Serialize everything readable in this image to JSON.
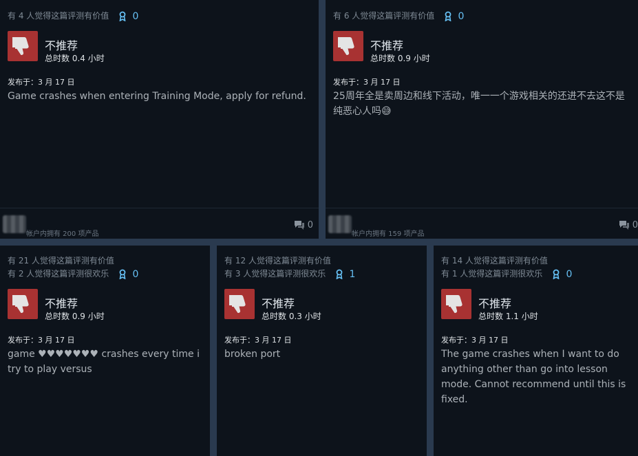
{
  "reviews": [
    {
      "helpful": "有 4 人觉得这篇评测有价值",
      "funny": "",
      "awards": "0",
      "verdict": "不推荐",
      "hours": "总时数 0.4 小时",
      "posted": "发布于：3 月 17 日",
      "body": "Game crashes when entering Training Mode, apply for refund.",
      "owned": "帐户内拥有 200 项产品",
      "comments": "0"
    },
    {
      "helpful": "有 6 人觉得这篇评测有价值",
      "funny": "",
      "awards": "0",
      "verdict": "不推荐",
      "hours": "总时数 0.9 小时",
      "posted": "发布于：3 月 17 日",
      "body": "25周年全是卖周边和线下活动，唯一一个游戏相关的还进不去这不是纯恶心人吗😅",
      "owned": "帐户内拥有 159 项产品",
      "comments": "0"
    },
    {
      "helpful": "有 21 人觉得这篇评测有价值",
      "funny": "有 2 人觉得这篇评测很欢乐",
      "awards": "0",
      "verdict": "不推荐",
      "hours": "总时数 0.9 小时",
      "posted": "发布于：3 月 17 日",
      "body": "game ♥♥♥♥♥♥♥ crashes every time i try to play versus"
    },
    {
      "helpful": "有 12 人觉得这篇评测有价值",
      "funny": "有 3 人觉得这篇评测很欢乐",
      "awards": "1",
      "verdict": "不推荐",
      "hours": "总时数 0.3 小时",
      "posted": "发布于：3 月 17 日",
      "body": "broken port"
    },
    {
      "helpful": "有 14 人觉得这篇评测有价值",
      "funny": "有 1 人觉得这篇评测很欢乐",
      "awards": "0",
      "verdict": "不推荐",
      "hours": "总时数 1.1 小时",
      "posted": "发布于：3 月 17 日",
      "body": "The game crashes when I want to do anything other than go into lesson mode. Cannot recommend until this is fixed."
    }
  ]
}
